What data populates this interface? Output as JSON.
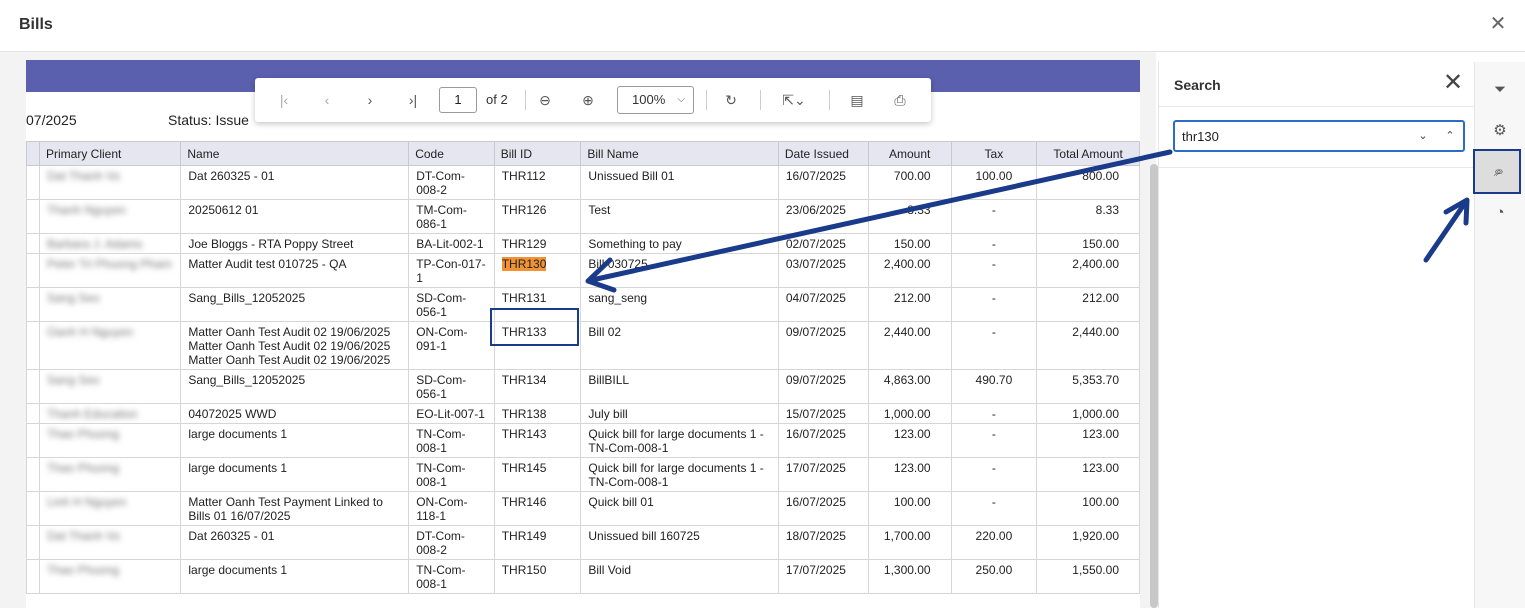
{
  "dialog": {
    "title": "Bills"
  },
  "report": {
    "date_fragment": "07/2025",
    "status_label": "Status:",
    "status_value": "Issue"
  },
  "toolbar": {
    "page_number": "1",
    "page_of": "of 2",
    "zoom": "100%"
  },
  "icons": {
    "close": "close-icon",
    "first": "first-page-icon",
    "prev": "prev-page-icon",
    "next": "next-page-icon",
    "last": "last-page-icon",
    "zoom_out": "zoom-out-icon",
    "zoom_in": "zoom-in-icon",
    "refresh": "refresh-icon",
    "export": "export-icon",
    "document": "document-icon",
    "print": "print-icon",
    "filter": "filter-icon",
    "settings": "gear-icon",
    "search": "search-icon",
    "gauge": "gauge-icon"
  },
  "table": {
    "columns": [
      "Primary Client",
      "Name",
      "Code",
      "Bill ID",
      "Bill Name",
      "Date Issued",
      "Amount",
      "Tax",
      "Total Amount"
    ],
    "rows": [
      {
        "client": "Dat Thanh Vo",
        "name": "Dat 260325 - 01",
        "code": "DT-Com-008-2",
        "bill_id": "THR112",
        "bill_name": "Unissued Bill 01",
        "date": "16/07/2025",
        "amount": "700.00",
        "tax": "100.00",
        "total": "800.00"
      },
      {
        "client": "Thanh Nguyen",
        "name": "20250612 01",
        "code": "TM-Com-086-1",
        "bill_id": "THR126",
        "bill_name": "Test",
        "date": "23/06/2025",
        "amount": "8.33",
        "tax": "-",
        "total": "8.33"
      },
      {
        "client": "Barbara J. Adams",
        "name": "Joe Bloggs - RTA Poppy Street",
        "code": "BA-Lit-002-1",
        "bill_id": "THR129",
        "bill_name": "Something to pay",
        "date": "02/07/2025",
        "amount": "150.00",
        "tax": "-",
        "total": "150.00"
      },
      {
        "client": "Peter Tri Phuong Pham",
        "name": "Matter Audit test 010725 - QA",
        "code": "TP-Con-017-1",
        "bill_id": "THR130",
        "bill_name": "Bill 030725",
        "date": "03/07/2025",
        "amount": "2,400.00",
        "tax": "-",
        "total": "2,400.00"
      },
      {
        "client": "Sang Seo",
        "name": "Sang_Bills_12052025",
        "code": "SD-Com-056-1",
        "bill_id": "THR131",
        "bill_name": "sang_seng",
        "date": "04/07/2025",
        "amount": "212.00",
        "tax": "-",
        "total": "212.00"
      },
      {
        "client": "Oanh H Nguyen",
        "name": "Matter Oanh Test Audit 02 19/06/2025 Matter Oanh Test Audit 02 19/06/2025 Matter Oanh Test Audit 02 19/06/2025",
        "code": "ON-Com-091-1",
        "bill_id": "THR133",
        "bill_name": "Bill 02",
        "date": "09/07/2025",
        "amount": "2,440.00",
        "tax": "-",
        "total": "2,440.00"
      },
      {
        "client": "Sang Seo",
        "name": "Sang_Bills_12052025",
        "code": "SD-Com-056-1",
        "bill_id": "THR134",
        "bill_name": "BillBILL",
        "date": "09/07/2025",
        "amount": "4,863.00",
        "tax": "490.70",
        "total": "5,353.70"
      },
      {
        "client": "Thanh Education",
        "name": "04072025 WWD",
        "code": "EO-Lit-007-1",
        "bill_id": "THR138",
        "bill_name": "July bill",
        "date": "15/07/2025",
        "amount": "1,000.00",
        "tax": "-",
        "total": "1,000.00"
      },
      {
        "client": "Thao Phuong",
        "name": "large documents 1",
        "code": "TN-Com-008-1",
        "bill_id": "THR143",
        "bill_name": "Quick bill for large documents 1 - TN-Com-008-1",
        "date": "16/07/2025",
        "amount": "123.00",
        "tax": "-",
        "total": "123.00"
      },
      {
        "client": "Thao Phuong",
        "name": "large documents 1",
        "code": "TN-Com-008-1",
        "bill_id": "THR145",
        "bill_name": "Quick bill for large documents 1 - TN-Com-008-1",
        "date": "17/07/2025",
        "amount": "123.00",
        "tax": "-",
        "total": "123.00"
      },
      {
        "client": "Linh H Nguyen",
        "name": "Matter Oanh Test Payment Linked to Bills 01 16/07/2025",
        "code": "ON-Com-118-1",
        "bill_id": "THR146",
        "bill_name": "Quick bill 01",
        "date": "16/07/2025",
        "amount": "100.00",
        "tax": "-",
        "total": "100.00"
      },
      {
        "client": "Dat Thanh Vo",
        "name": "Dat 260325 - 01",
        "code": "DT-Com-008-2",
        "bill_id": "THR149",
        "bill_name": "Unissued bill 160725",
        "date": "18/07/2025",
        "amount": "1,700.00",
        "tax": "220.00",
        "total": "1,920.00"
      },
      {
        "client": "Thao Phuong",
        "name": "large documents 1",
        "code": "TN-Com-008-1",
        "bill_id": "THR150",
        "bill_name": "Bill Void",
        "date": "17/07/2025",
        "amount": "1,300.00",
        "tax": "250.00",
        "total": "1,550.00"
      }
    ]
  },
  "search_panel": {
    "title": "Search",
    "query": "thr130"
  },
  "colors": {
    "band": "#5a5fae",
    "highlight": "#f19335",
    "annotation": "#1a3a8a",
    "focus": "#2d6cc4"
  }
}
